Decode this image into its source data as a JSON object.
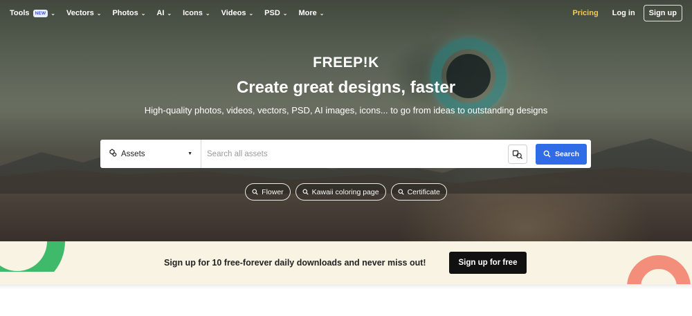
{
  "nav": {
    "items": [
      {
        "label": "Tools",
        "badge": "NEW"
      },
      {
        "label": "Vectors"
      },
      {
        "label": "Photos"
      },
      {
        "label": "AI"
      },
      {
        "label": "Icons"
      },
      {
        "label": "Videos"
      },
      {
        "label": "PSD"
      },
      {
        "label": "More"
      }
    ],
    "pricing": "Pricing",
    "login": "Log in",
    "signup": "Sign up"
  },
  "hero": {
    "logo": "FREEP!K",
    "headline": "Create great designs, faster",
    "subline": "High-quality photos, videos, vectors, PSD, AI images, icons... to go from ideas to outstanding designs"
  },
  "search": {
    "scope": "Assets",
    "placeholder": "Search all assets",
    "button": "Search"
  },
  "chips": [
    "Flower",
    "Kawaii coloring page",
    "Certificate"
  ],
  "banner": {
    "text": "Sign up for 10 free-forever daily downloads and never miss out!",
    "button": "Sign up for free"
  },
  "colors": {
    "accent_blue": "#2f6ce6",
    "pricing_yellow": "#f5c95d",
    "banner_bg": "#f8f3e3",
    "ring_green": "#3fb96a",
    "ring_pink": "#f28e7a"
  }
}
